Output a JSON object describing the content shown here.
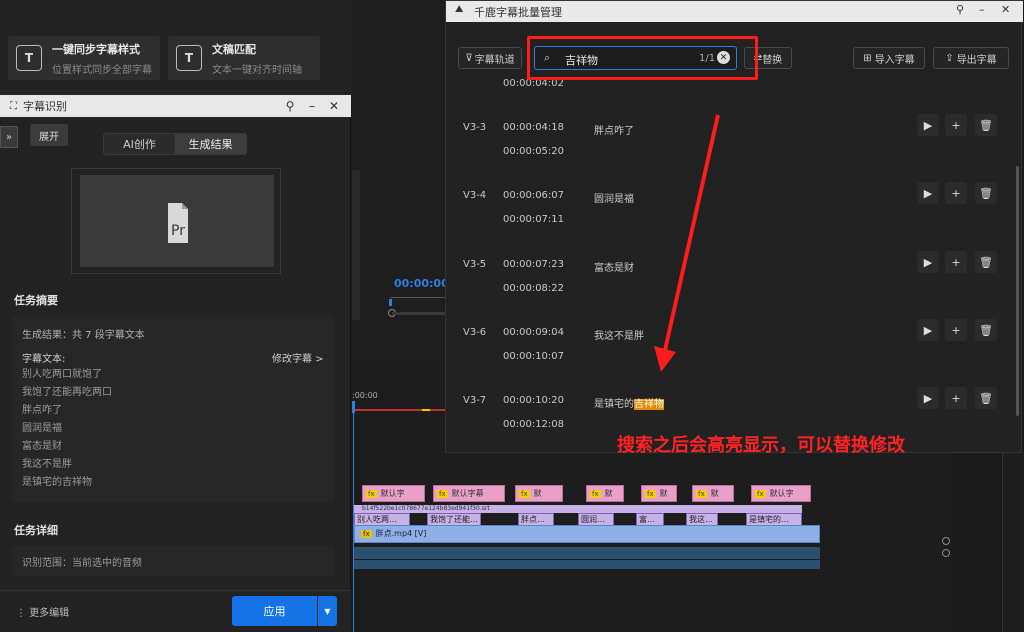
{
  "left_top": {
    "cards": [
      {
        "title": "一键同步字幕样式",
        "sub": "位置样式同步全部字幕",
        "icon": "text-sync-icon"
      },
      {
        "title": "文稿匹配",
        "sub": "文本一键对齐时间轴",
        "icon": "text-match-icon"
      }
    ]
  },
  "subtitle_panel": {
    "title": "字幕识别",
    "expand_label": "展开",
    "tabs": [
      "AI创作",
      "生成结果"
    ],
    "active_tab": 1,
    "preview_icon": "Pr",
    "summary": {
      "title": "任务摘要",
      "result": "生成结果：共 7 段字幕文本",
      "text_label": "字幕文本:",
      "modify": "修改字幕 >",
      "lines": [
        "别人吃两口就饱了",
        "我饱了还能再吃两口",
        "胖点咋了",
        "圆润是福",
        "富态是财",
        "我这不是胖",
        "是镇宅的吉祥物"
      ]
    },
    "detail": {
      "title": "任务详细",
      "range": "识别范围：当前选中的音频"
    },
    "more": "更多编辑",
    "apply": "应用"
  },
  "middle": {
    "timecode": "00:00:00",
    "ruler_start": ":00:00"
  },
  "batch_manager": {
    "title": "千鹿字幕批量管理",
    "toolbar": {
      "track_label": "字幕轨道",
      "search_value": "吉祥物",
      "search_count": "1/1",
      "replace_label": "替换",
      "import_label": "导入字幕",
      "export_label": "导出字幕"
    },
    "partial_top_time": "00:00:04:02",
    "rows": [
      {
        "id": "V3-3",
        "start": "00:00:04:18",
        "end": "00:00:05:20",
        "text": "胖点咋了",
        "pre": "",
        "hl": ""
      },
      {
        "id": "V3-4",
        "start": "00:00:06:07",
        "end": "00:00:07:11",
        "text": "圆润是福",
        "pre": "",
        "hl": ""
      },
      {
        "id": "V3-5",
        "start": "00:00:07:23",
        "end": "00:00:08:22",
        "text": "富态是财",
        "pre": "",
        "hl": ""
      },
      {
        "id": "V3-6",
        "start": "00:00:09:04",
        "end": "00:00:10:07",
        "text": "我这不是胖",
        "pre": "",
        "hl": ""
      },
      {
        "id": "V3-7",
        "start": "00:00:10:20",
        "end": "00:00:12:08",
        "text": "",
        "pre": "是镇宅的",
        "hl": "吉祥物"
      }
    ]
  },
  "annotation": "搜索之后会高亮显示，可以替换修改",
  "timeline": {
    "pink_clips": [
      "默认字",
      "默认字幕",
      "默",
      "默",
      "默",
      "默",
      "默",
      "默认字"
    ],
    "clip_name": "b14f522be1c078677e124b83ed941f30.srt",
    "purple_clips": [
      "别人吃两…",
      "我饱了还能…",
      "胖点…",
      "圆润…",
      "富…",
      "我这…",
      "是镇宅的…"
    ],
    "video_clip": "胖点.mp4 [V]"
  },
  "colors": {
    "accent": "#1473e6",
    "highlight": "#e58a00",
    "annotation": "#ff2222"
  }
}
